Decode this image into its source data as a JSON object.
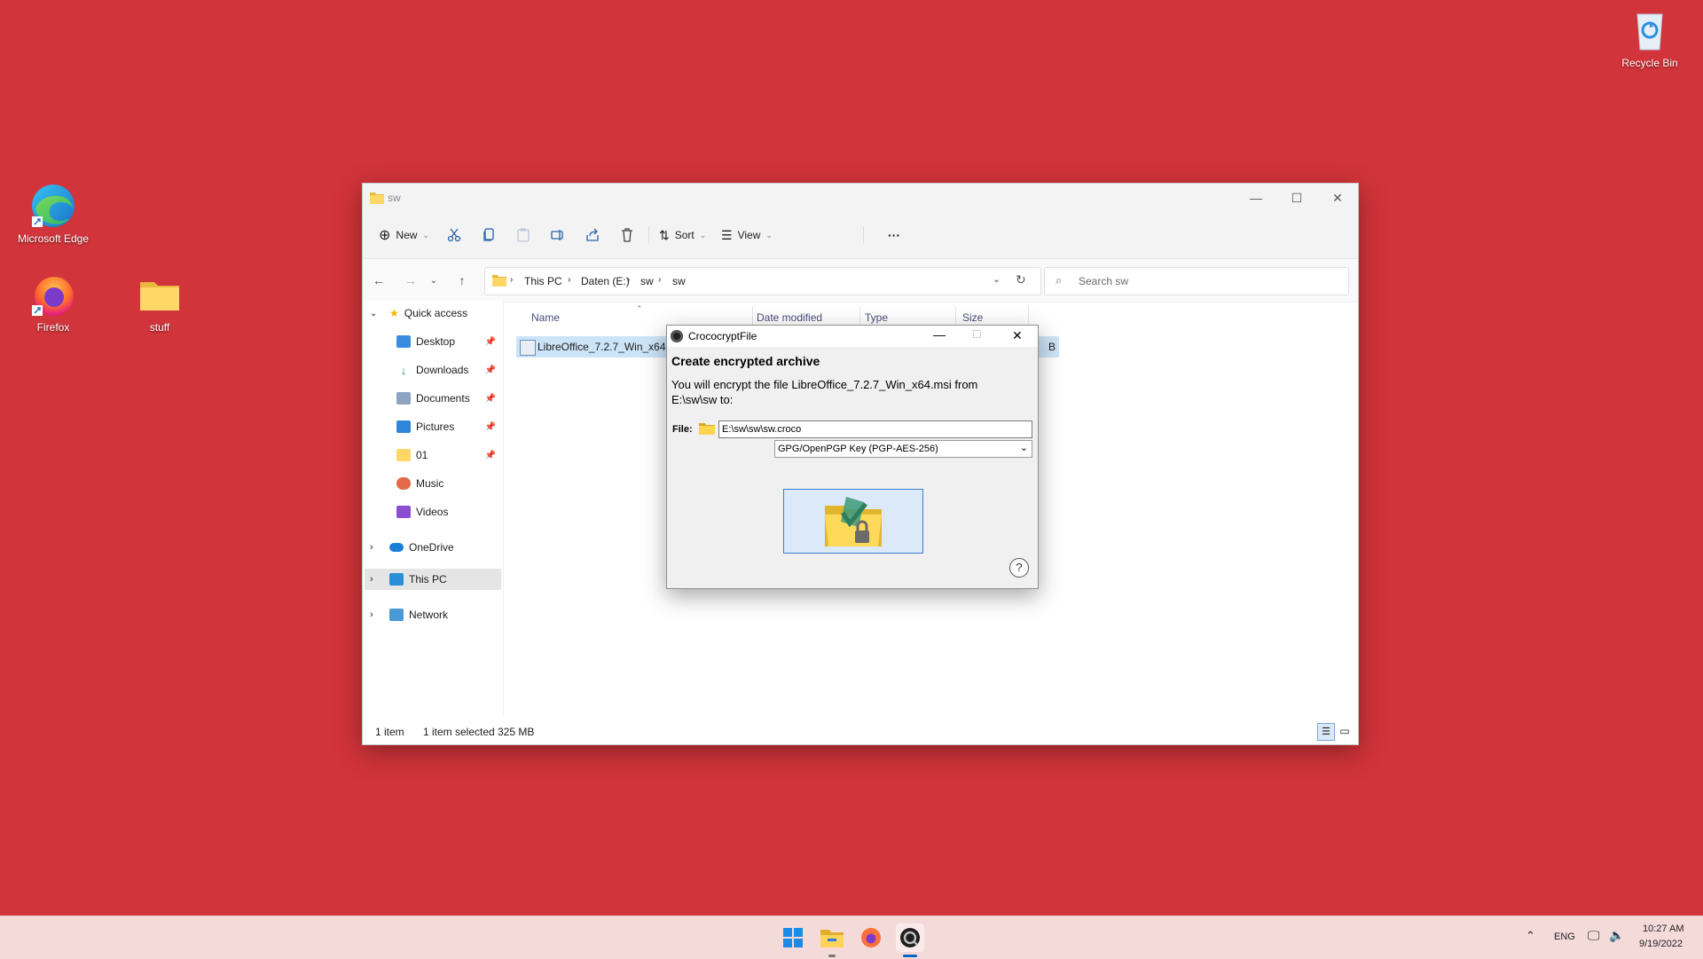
{
  "desktop": {
    "icons": [
      {
        "label": "Microsoft Edge"
      },
      {
        "label": "Firefox"
      },
      {
        "label": "stuff"
      },
      {
        "label": "Recycle Bin"
      }
    ]
  },
  "explorer": {
    "title": "sw",
    "toolbar": {
      "new_label": "New",
      "sort_label": "Sort",
      "view_label": "View",
      "more_label": "···"
    },
    "breadcrumb": [
      "This PC",
      "Daten (E:)",
      "sw",
      "sw"
    ],
    "search_placeholder": "Search sw",
    "sidebar": {
      "quick_access": "Quick access",
      "items": [
        "Desktop",
        "Downloads",
        "Documents",
        "Pictures",
        "01",
        "Music",
        "Videos"
      ],
      "onedrive": "OneDrive",
      "this_pc": "This PC",
      "network": "Network"
    },
    "columns": [
      "Name",
      "Date modified",
      "Type",
      "Size"
    ],
    "files": [
      {
        "name": "LibreOffice_7.2.7_Win_x64",
        "size_fragment": "B"
      }
    ],
    "status": {
      "count": "1 item",
      "selected": "1 item selected",
      "size": "325 MB"
    }
  },
  "dialog": {
    "title": "CrococryptFile",
    "heading": "Create encrypted archive",
    "description": "You will encrypt the file LibreOffice_7.2.7_Win_x64.msi from E:\\sw\\sw to:",
    "file_label": "File:",
    "file_value": "E:\\sw\\sw\\sw.croco",
    "key_option": "GPG/OpenPGP Key (PGP-AES-256)",
    "help_symbol": "?"
  },
  "taskbar": {
    "lang": "ENG",
    "time": "10:27 AM",
    "date": "9/19/2022"
  },
  "colors": {
    "desktop": "#d1343a",
    "taskbar": "#f5dada",
    "accent": "#0067c0"
  }
}
